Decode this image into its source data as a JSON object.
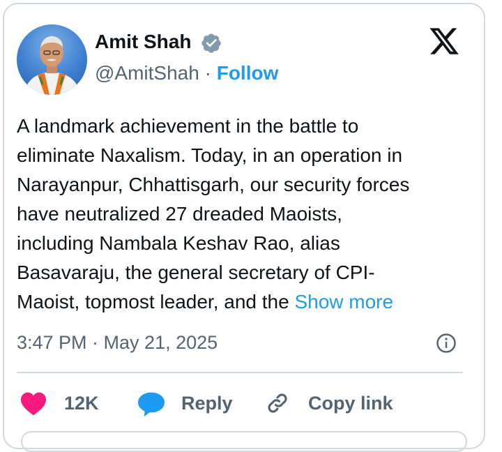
{
  "post": {
    "author": {
      "name": "Amit Shah",
      "handle": "@AmitShah",
      "separator": "·",
      "follow_label": "Follow",
      "verified": true
    },
    "text_lines": [
      "A landmark achievement in the battle to",
      "eliminate Naxalism. Today, in an operation in",
      "Narayanpur, Chhattisgarh, our security forces",
      "have neutralized 27 dreaded Maoists,",
      "including Nambala Keshav Rao, alias",
      "Basavaraju, the general secretary of CPI-",
      "Maoist, topmost leader, and the"
    ],
    "show_more_label": "Show more",
    "timestamp": "3:47 PM · May 21, 2025",
    "actions": {
      "like_count": "12K",
      "reply_label": "Reply",
      "copy_link_label": "Copy link"
    }
  },
  "icons": {
    "brand": "x-logo-icon",
    "verified": "verified-badge-icon",
    "info": "info-icon",
    "like": "heart-icon",
    "reply": "speech-bubble-icon",
    "copy_link": "link-icon"
  },
  "colors": {
    "accent": "#1d9bf0",
    "text": "#0f1419",
    "muted": "#536471",
    "like": "#f91880",
    "border": "#cfd9de"
  }
}
